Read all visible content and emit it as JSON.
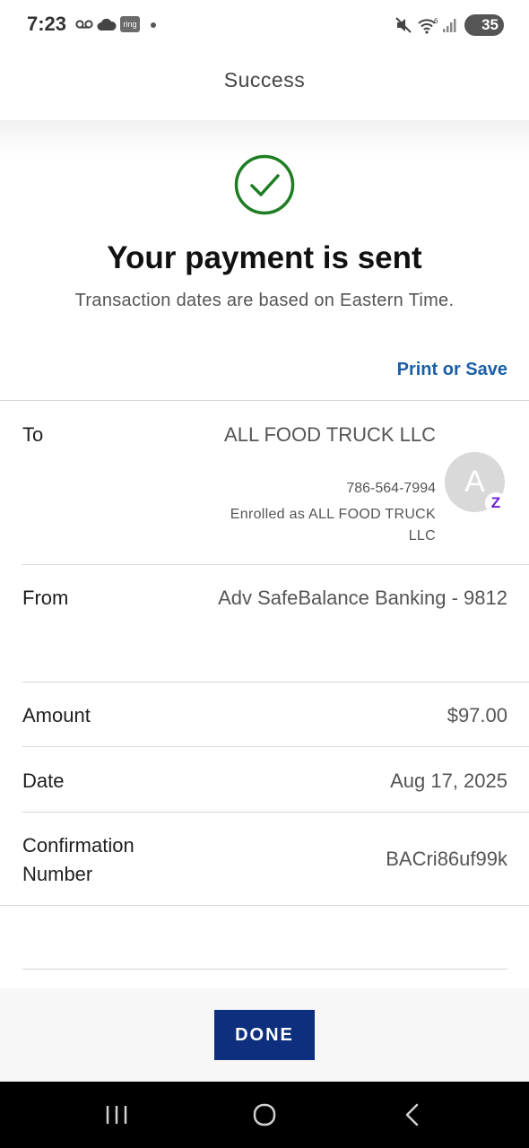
{
  "status_bar": {
    "time": "7:23",
    "ring_label": "ring",
    "wifi_label": "6",
    "battery": "35",
    "icons": [
      "voicemail-icon",
      "cloud-icon",
      "ring-app-icon",
      "dot-icon",
      "mute-icon",
      "wifi-icon",
      "signal-icon",
      "battery-icon"
    ]
  },
  "header": {
    "title": "Success"
  },
  "success": {
    "icon": "check-circle-icon",
    "headline": "Your payment is sent",
    "subline": "Transaction dates are based on Eastern Time."
  },
  "actions": {
    "print_save": "Print or Save",
    "done": "DONE"
  },
  "details": {
    "to": {
      "label": "To",
      "name": "ALL FOOD TRUCK LLC",
      "phone": "786-564-7994",
      "enrolled": "Enrolled as ALL FOOD TRUCK LLC",
      "avatar_letter": "A",
      "badge": "Z"
    },
    "from": {
      "label": "From",
      "value": "Adv SafeBalance Banking - 9812"
    },
    "amount": {
      "label": "Amount",
      "value": "$97.00"
    },
    "date": {
      "label": "Date",
      "value": "Aug 17, 2025"
    },
    "confirmation": {
      "label": "Confirmation Number",
      "value": "BACri86uf99k"
    }
  },
  "colors": {
    "success_green": "#1e7d22",
    "link_blue": "#1a5fa8",
    "done_button": "#0e2f7e",
    "zelle_purple": "#6d1ed4"
  },
  "nav_bar": {
    "icons": [
      "recent-apps-icon",
      "home-icon",
      "back-icon"
    ]
  }
}
